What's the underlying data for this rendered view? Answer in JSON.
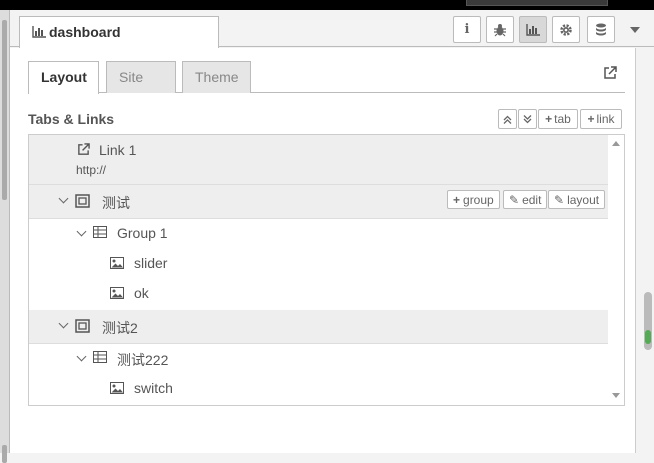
{
  "header": {
    "tab_label": "dashboard",
    "buttons": [
      "info",
      "debug",
      "dashboard",
      "settings",
      "context"
    ]
  },
  "tabs": [
    {
      "label": "Layout",
      "active": true
    },
    {
      "label": "Site",
      "active": false
    },
    {
      "label": "Theme",
      "active": false
    }
  ],
  "section": {
    "title": "Tabs & Links",
    "add_tab": "tab",
    "add_link": "link"
  },
  "row_buttons": {
    "group": "group",
    "edit": "edit",
    "layout": "layout"
  },
  "items": [
    {
      "type": "link",
      "label": "Link 1",
      "url": "http://"
    },
    {
      "type": "tab",
      "label": "测试"
    },
    {
      "type": "group",
      "label": "Group 1"
    },
    {
      "type": "widget",
      "label": "slider"
    },
    {
      "type": "widget",
      "label": "ok"
    },
    {
      "type": "tab",
      "label": "测试2"
    },
    {
      "type": "group",
      "label": "测试222"
    },
    {
      "type": "widget",
      "label": "switch"
    }
  ],
  "colors": {
    "selected_row": "#eeeeee",
    "accent_green": "#55aa55"
  }
}
